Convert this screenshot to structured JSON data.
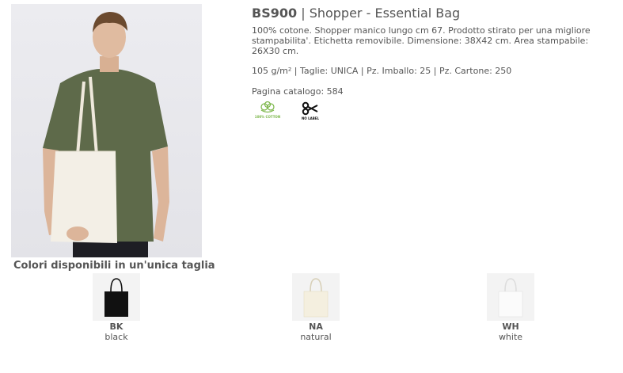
{
  "product": {
    "code": "BS900",
    "separator": " | ",
    "name": "Shopper - Essential Bag",
    "description": "100% cotone. Shopper manico lungo cm 67. Prodotto stirato per una migliore stampabilita'. Etichetta removibile. Dimensione: 38X42 cm. Area stampabile: 26X30 cm.",
    "specs": "105 g/m² | Taglie: UNICA | Pz. Imballo: 25 | Pz. Cartone: 250",
    "catalog_page": "Pagina catalogo: 584"
  },
  "badges": [
    {
      "icon": "cotton-boll-icon",
      "label": "100% COTTON",
      "color": "#7ab648"
    },
    {
      "icon": "scissors-icon",
      "label": "NO LABEL",
      "color": "#111111"
    }
  ],
  "colors_title": "Colori disponibili in un'unica taglia",
  "colors": [
    {
      "code": "BK",
      "name": "black",
      "bag_color": "#111111"
    },
    {
      "code": "NA",
      "name": "natural",
      "bag_color": "#f4efdf"
    },
    {
      "code": "WH",
      "name": "white",
      "bag_color": "#fbfbfb"
    }
  ]
}
